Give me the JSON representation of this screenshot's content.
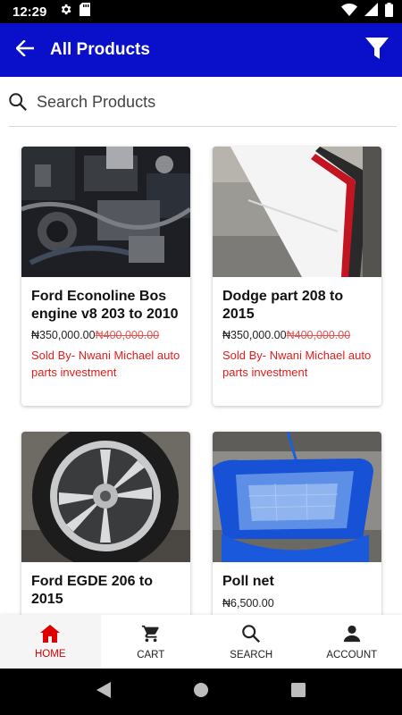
{
  "status_bar": {
    "time": "12:29",
    "left_icons": [
      "gear-icon",
      "sd-card-icon"
    ],
    "right_icons": [
      "wifi-icon",
      "signal-icon",
      "battery-icon"
    ]
  },
  "app_bar": {
    "title": "All Products",
    "background": "#0a10c9",
    "back_icon": "arrow-left-icon",
    "filter_icon": "filter-icon"
  },
  "search": {
    "placeholder": "Search Products",
    "icon": "search-icon"
  },
  "products": [
    {
      "title": "Ford Econoline Bos engine v8 203 to 2010",
      "price": "₦350,000.00",
      "old_price": "₦400,000.00",
      "seller": "Sold By- Nwani Michael auto parts investment",
      "image": "engine-photo"
    },
    {
      "title": "Dodge part 208 to 2015",
      "price": "₦350,000.00",
      "old_price": "₦400,000.00",
      "seller": "Sold By- Nwani Michael auto parts investment",
      "image": "rear-bumper-photo"
    },
    {
      "title": "Ford EGDE 206 to 2015",
      "price": "",
      "old_price": "",
      "seller": "",
      "image": "alloy-wheel-photo"
    },
    {
      "title": "Poll net",
      "price": "₦6,500.00",
      "old_price": "",
      "seller": "",
      "image": "pool-net-photo"
    }
  ],
  "bottom_nav": {
    "items": [
      {
        "label": "HOME",
        "icon": "home-icon",
        "active": true
      },
      {
        "label": "CART",
        "icon": "cart-icon",
        "active": false
      },
      {
        "label": "SEARCH",
        "icon": "search-icon",
        "active": false
      },
      {
        "label": "ACCOUNT",
        "icon": "account-icon",
        "active": false
      }
    ],
    "active_color": "#e00000"
  },
  "system_nav": [
    "back-triangle-icon",
    "home-circle-icon",
    "recents-square-icon"
  ]
}
